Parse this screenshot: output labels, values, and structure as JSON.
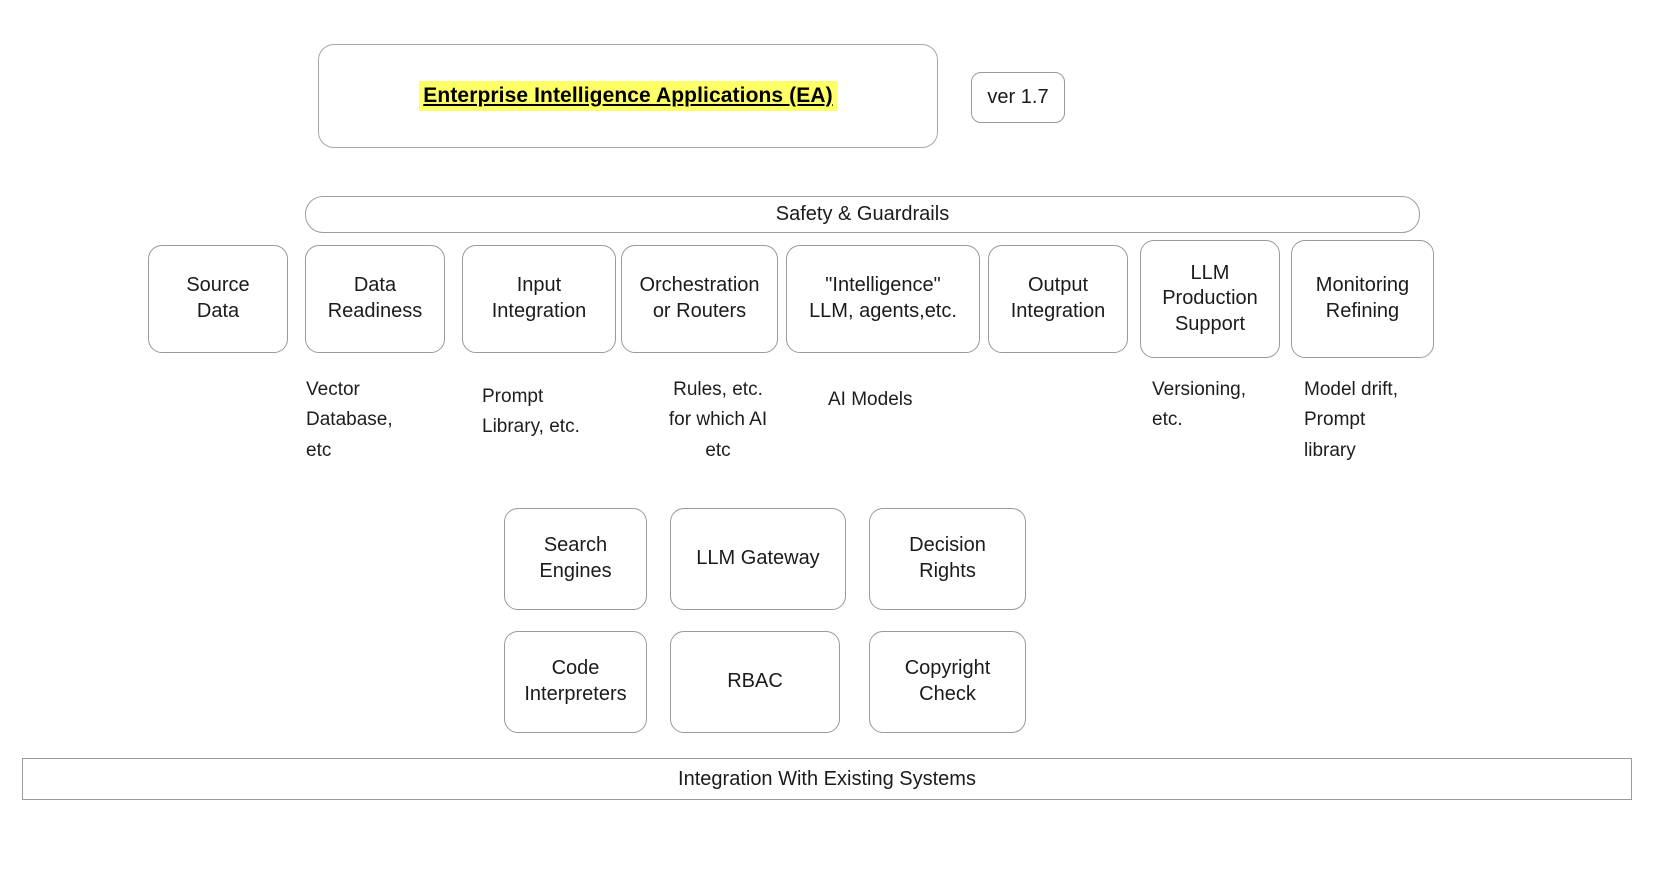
{
  "diagram": {
    "title": "Enterprise Intelligence Applications (EA)",
    "version": "ver 1.7",
    "highlight_color": "#ffff66",
    "safety_bar": "Safety & Guardrails",
    "bottom_bar": "Integration With Existing Systems",
    "pillars": [
      {
        "label": "Source\nData"
      },
      {
        "label": "Data\nReadiness"
      },
      {
        "label": "Input\nIntegration"
      },
      {
        "label": "Orchestration\nor Routers"
      },
      {
        "label": "\"Intelligence\"\nLLM, agents,etc."
      },
      {
        "label": "Output\nIntegration"
      },
      {
        "label": "LLM\nProduction\nSupport"
      },
      {
        "label": "Monitoring\nRefining"
      }
    ],
    "captions": [
      {
        "text": "Vector\nDatabase,\netc"
      },
      {
        "text": "Prompt\nLibrary, etc."
      },
      {
        "text": "Rules, etc.\nfor which AI\netc"
      },
      {
        "text": "AI Models"
      },
      {
        "text": "Versioning,\netc."
      },
      {
        "text": "Model drift,\nPrompt\nlibrary"
      }
    ],
    "components_row1": [
      {
        "label": "Search\nEngines"
      },
      {
        "label": "LLM Gateway"
      },
      {
        "label": "Decision\nRights"
      }
    ],
    "components_row2": [
      {
        "label": "Code\nInterpreters"
      },
      {
        "label": "RBAC"
      },
      {
        "label": "Copyright\nCheck"
      }
    ]
  }
}
